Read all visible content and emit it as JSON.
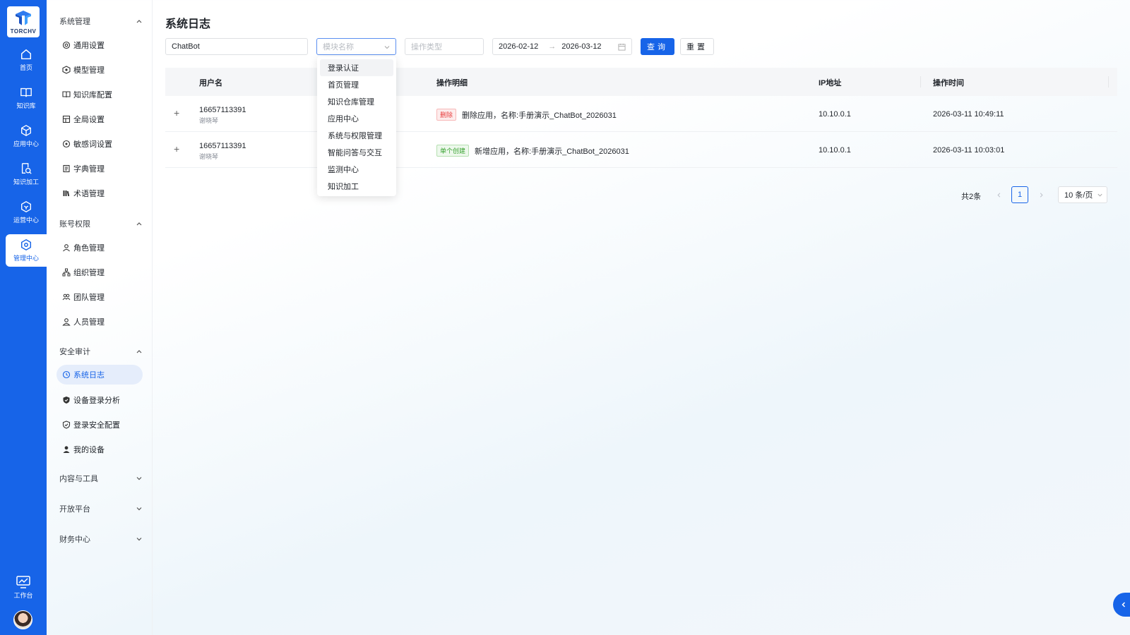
{
  "rail": {
    "logo_text": "TORCHV",
    "items": [
      {
        "label": "首页",
        "icon": "home-icon"
      },
      {
        "label": "知识库",
        "icon": "book-icon"
      },
      {
        "label": "应用中心",
        "icon": "cube-icon"
      },
      {
        "label": "知识加工",
        "icon": "edit-search-icon"
      },
      {
        "label": "运营中心",
        "icon": "hexagon-icon"
      },
      {
        "label": "管理中心",
        "icon": "settings-hexagon-icon",
        "active": true
      }
    ],
    "workbench_label": "工作台"
  },
  "sidebar": {
    "groups": [
      {
        "label": "系统管理",
        "expanded": true,
        "items": [
          "通用设置",
          "模型管理",
          "知识库配置",
          "全局设置",
          "敏感词设置",
          "字典管理",
          "术语管理"
        ]
      },
      {
        "label": "账号权限",
        "expanded": true,
        "items": [
          "角色管理",
          "组织管理",
          "团队管理",
          "人员管理"
        ]
      },
      {
        "label": "安全审计",
        "expanded": true,
        "items": [
          "系统日志",
          "设备登录分析",
          "登录安全配置",
          "我的设备"
        ]
      },
      {
        "label": "内容与工具",
        "expanded": false
      },
      {
        "label": "开放平台",
        "expanded": false
      },
      {
        "label": "财务中心",
        "expanded": false
      }
    ],
    "active_item": "系统日志"
  },
  "page": {
    "title": "系统日志"
  },
  "filters": {
    "keyword_value": "ChatBot",
    "module_placeholder": "模块名称",
    "op_type_placeholder": "操作类型",
    "date_start": "2026-02-12",
    "date_sep": "→",
    "date_end": "2026-03-12",
    "query_label": "查询",
    "reset_label": "重置"
  },
  "module_dropdown": {
    "options": [
      "登录认证",
      "首页管理",
      "知识仓库管理",
      "应用中心",
      "系统与权限管理",
      "智能问答与交互",
      "监测中心",
      "知识加工"
    ],
    "hovered": "登录认证"
  },
  "table": {
    "columns": [
      "用户名",
      "操作明细",
      "IP地址",
      "操作时间"
    ],
    "rows": [
      {
        "username": "16657113391",
        "realname": "谢晓琴",
        "tag": "删除",
        "tag_color": "#e83f3f",
        "detail": "删除应用，名称:手册演示_ChatBot_2026031",
        "ip": "10.10.0.1",
        "time": "2026-03-11 10:49:11"
      },
      {
        "username": "16657113391",
        "realname": "谢晓琴",
        "tag": "单个创建",
        "tag_color": "#3aa332",
        "detail": "新增应用，名称:手册演示_ChatBot_2026031",
        "ip": "10.10.0.1",
        "time": "2026-03-11 10:03:01"
      }
    ]
  },
  "pagination": {
    "total_text": "共2条",
    "current_page": "1",
    "page_size": "10 条/页"
  },
  "colors": {
    "primary": "#1764e8"
  }
}
